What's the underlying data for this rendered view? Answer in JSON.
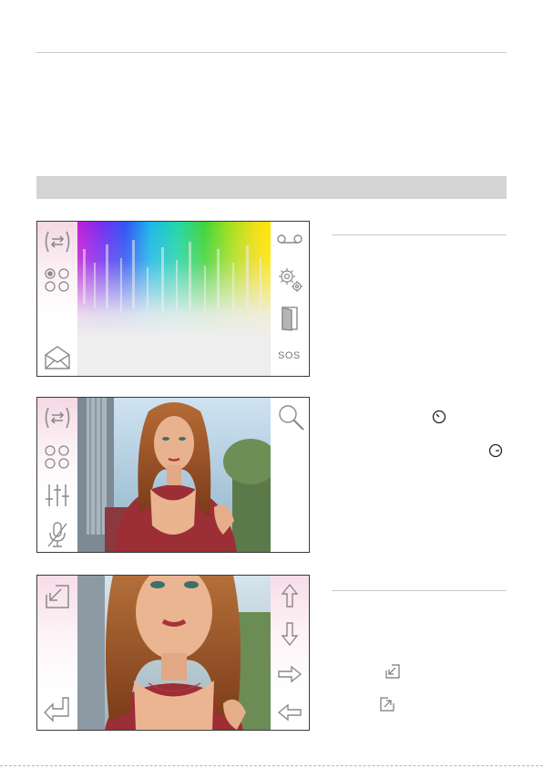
{
  "layout_rules": {
    "top_rule": true,
    "section_bar": true,
    "right_rules": 2
  },
  "screens": [
    {
      "id": "main-menu",
      "left_icons": [
        "intercom-transfer-icon",
        "radio-dots-icon",
        "envelope-icon"
      ],
      "right_icons": [
        "voicemail-icon",
        "settings-gears-icon",
        "door-open-icon"
      ],
      "sos_label": "SOS",
      "content": "color-spectrum"
    },
    {
      "id": "video-call",
      "left_icons": [
        "intercom-transfer-icon",
        "radio-dots-icon",
        "equalizer-sliders-icon",
        "mic-muted-icon"
      ],
      "right_icons": [
        "zoom-magnifier-icon"
      ],
      "content": "camera-feed"
    },
    {
      "id": "zoom-view",
      "left_icons": [
        "zoom-in-corner-icon",
        "back-return-icon"
      ],
      "right_icons": [
        "arrow-up-icon",
        "arrow-down-icon",
        "arrow-right-icon",
        "arrow-left-icon"
      ],
      "content": "camera-feed-zoomed"
    }
  ],
  "side_notes": [
    {
      "icon": "dial-left-icon"
    },
    {
      "icon": "dial-right-icon"
    },
    {
      "icon": "zoom-in-corner-icon"
    },
    {
      "icon": "zoom-out-corner-icon"
    }
  ],
  "colors": {
    "rule": "#c9c9c9",
    "section_bar": "#d4d4d4",
    "icon_stroke": "#8a8a8a",
    "frame": "#3a3a3a"
  }
}
